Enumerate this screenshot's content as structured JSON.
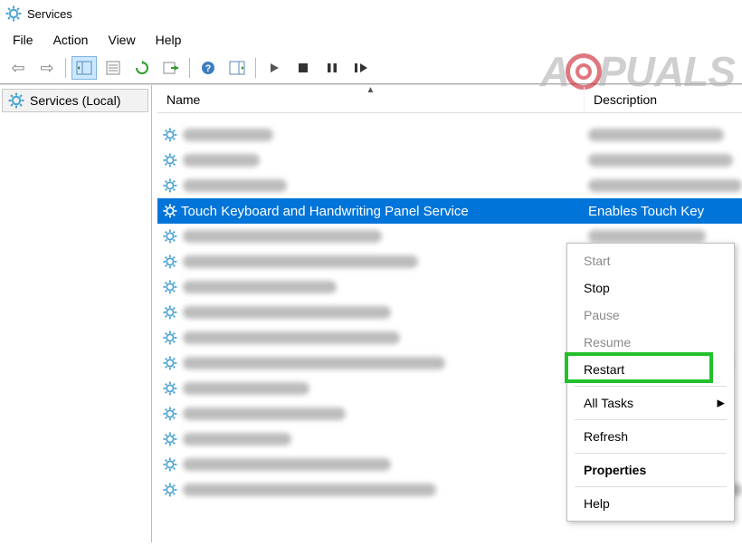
{
  "window": {
    "title": "Services"
  },
  "menubar": {
    "items": [
      "File",
      "Action",
      "View",
      "Help"
    ]
  },
  "toolbar": {
    "back": "⬅",
    "forward": "➡",
    "refresh": "↻",
    "play": "▶",
    "stop": "■",
    "pause": "❚❚",
    "restart": "❚▶"
  },
  "tree": {
    "root": "Services (Local)"
  },
  "columns": {
    "name": "Name",
    "description": "Description",
    "sort_indicator": "▲"
  },
  "services": {
    "rows": [
      {},
      {},
      {},
      {
        "selected": true,
        "name": "Touch Keyboard and Handwriting Panel Service",
        "description": "Enables Touch Key"
      },
      {},
      {},
      {},
      {},
      {},
      {},
      {},
      {},
      {},
      {},
      {}
    ]
  },
  "context_menu": {
    "items": [
      {
        "label": "Start",
        "state": "disabled"
      },
      {
        "label": "Stop",
        "state": "enabled"
      },
      {
        "label": "Pause",
        "state": "disabled"
      },
      {
        "label": "Resume",
        "state": "disabled"
      },
      {
        "label": "Restart",
        "state": "enabled",
        "highlight": true
      },
      {
        "sep": true
      },
      {
        "label": "All Tasks",
        "state": "enabled",
        "submenu": true
      },
      {
        "sep": true
      },
      {
        "label": "Refresh",
        "state": "enabled"
      },
      {
        "sep": true
      },
      {
        "label": "Properties",
        "state": "enabled",
        "bold": true
      },
      {
        "sep": true
      },
      {
        "label": "Help",
        "state": "enabled"
      }
    ]
  },
  "watermark": {
    "pre": "A",
    "post": "PUALS"
  }
}
